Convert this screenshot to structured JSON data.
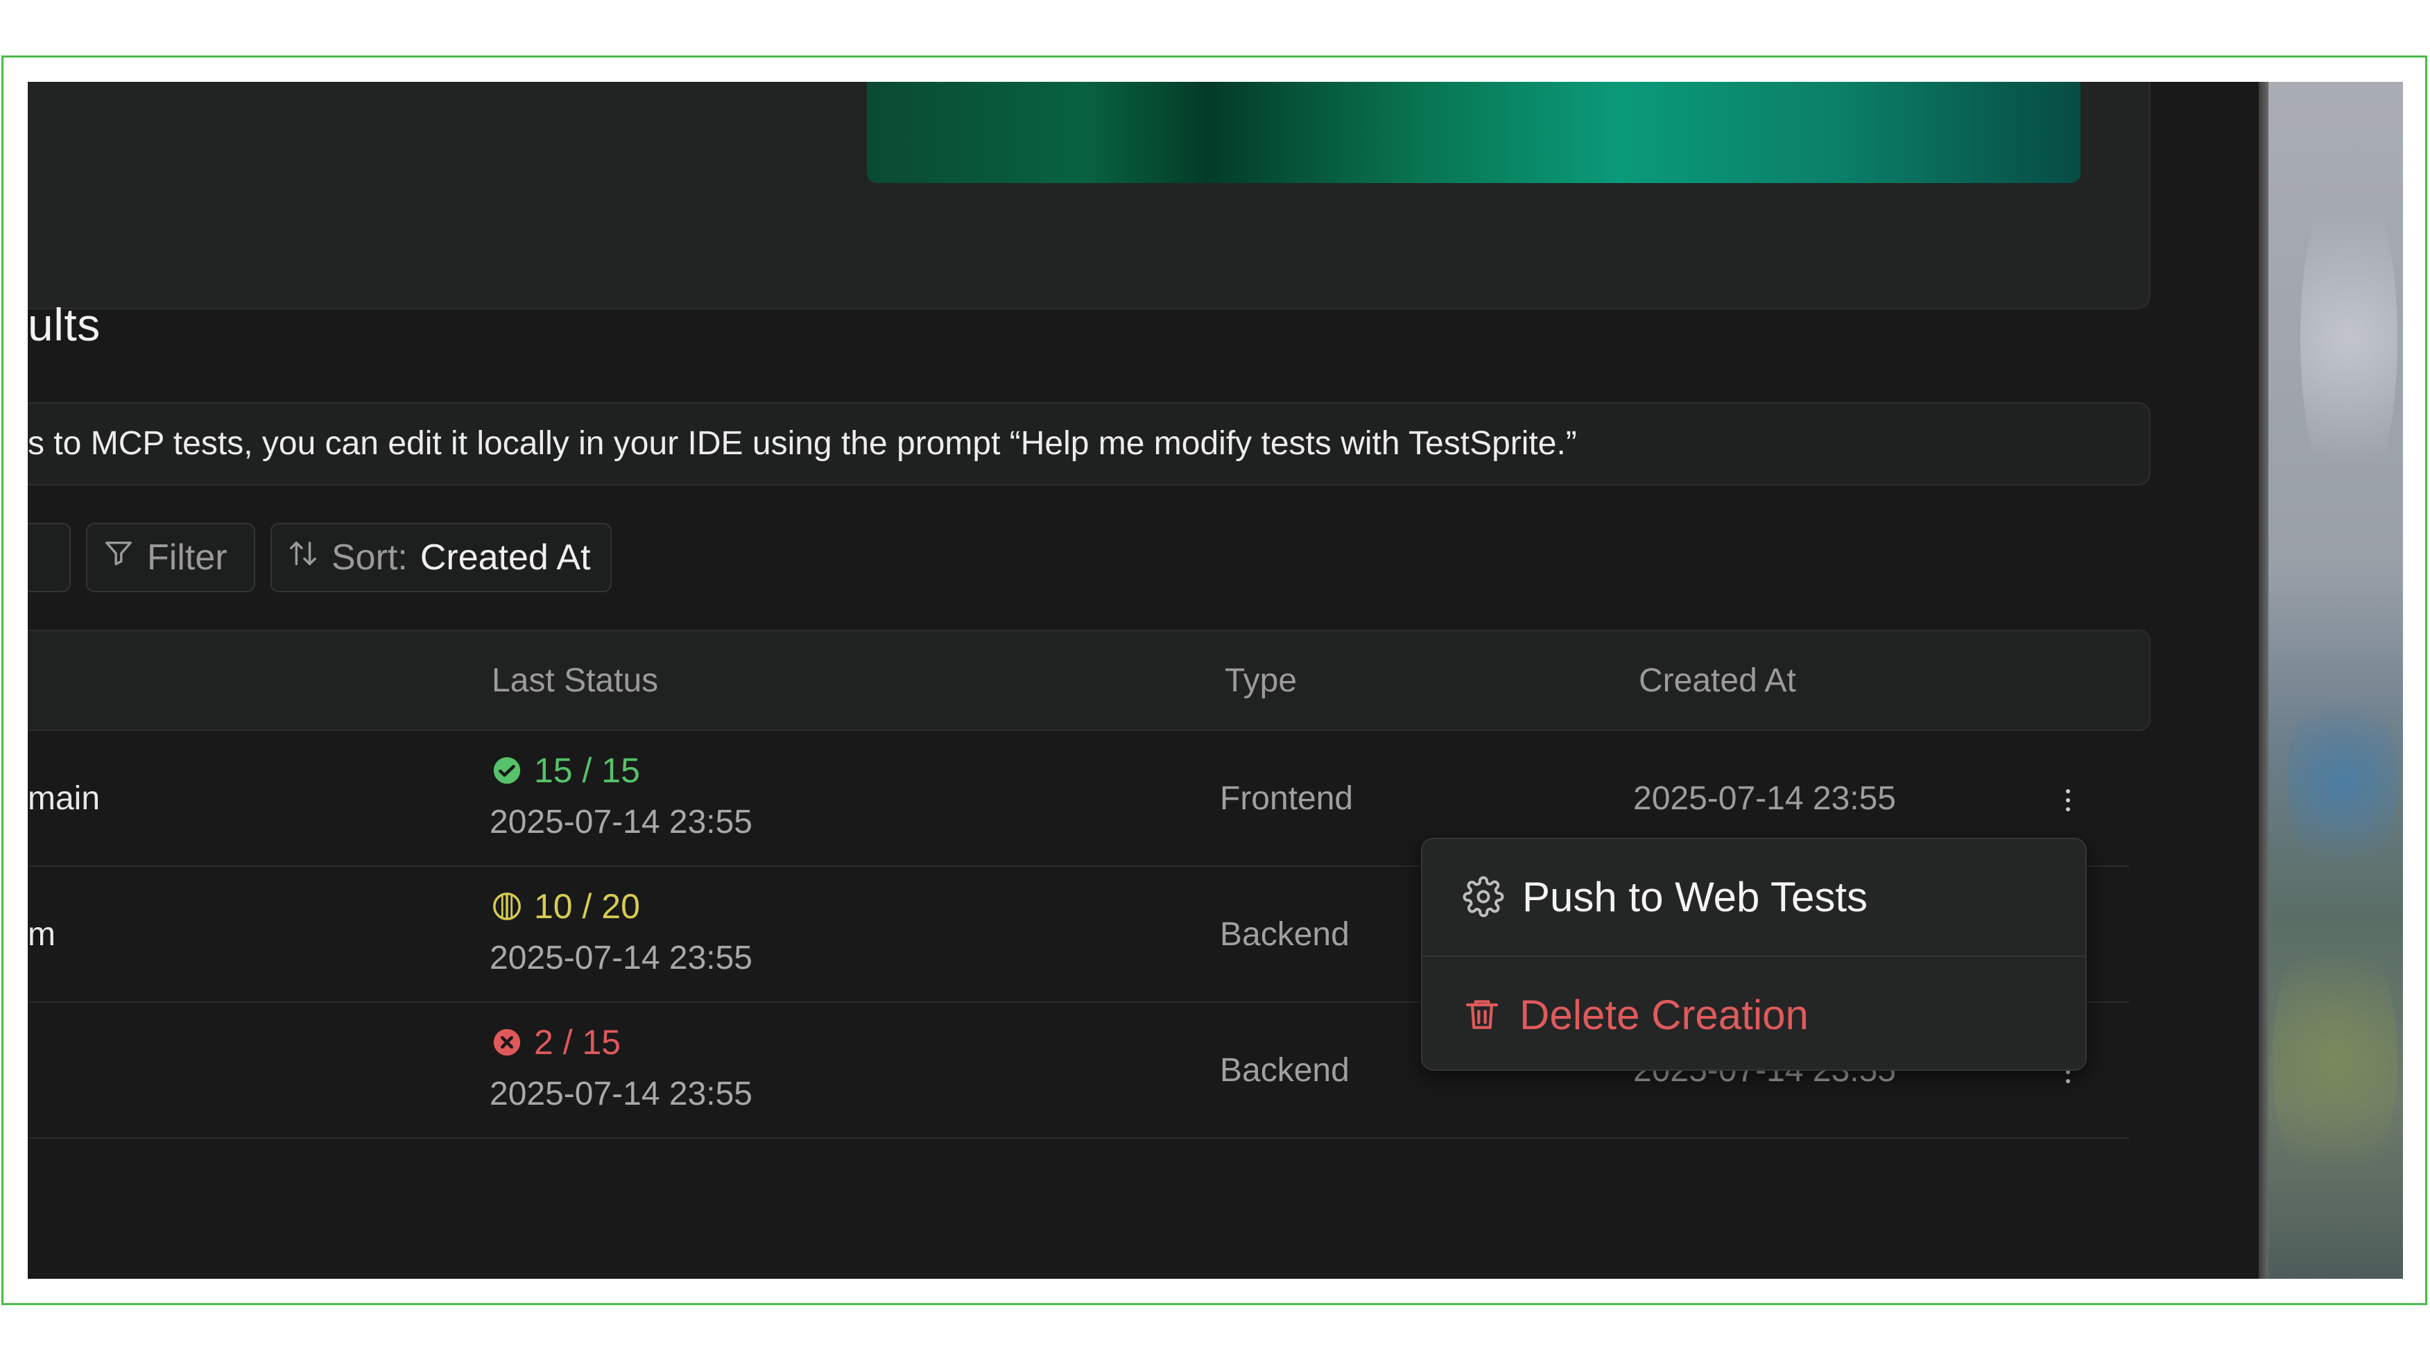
{
  "section": {
    "title_fragment": "ults"
  },
  "notice": {
    "text": "s to MCP tests, you can edit it locally in your IDE using the prompt “Help me modify tests with TestSprite.”"
  },
  "toolbar": {
    "filter_label": "Filter",
    "sort_prefix": "Sort:",
    "sort_value": "Created At"
  },
  "table": {
    "headers": {
      "last_status": "Last Status",
      "type": "Type",
      "created_at": "Created At"
    },
    "rows": [
      {
        "name": "main",
        "status_text": "15 / 15",
        "status_kind": "pass",
        "status_date": "2025-07-14 23:55",
        "type": "Frontend",
        "created_at": "2025-07-14 23:55"
      },
      {
        "name": "m",
        "status_text": "10 / 20",
        "status_kind": "partial",
        "status_date": "2025-07-14 23:55",
        "type": "Backend",
        "created_at": "2025-07-14 23:55"
      },
      {
        "name": "",
        "status_text": "2 / 15",
        "status_kind": "fail",
        "status_date": "2025-07-14 23:55",
        "type": "Backend",
        "created_at": "2025-07-14 23:55"
      }
    ]
  },
  "context_menu": {
    "push_label": "Push to Web Tests",
    "delete_label": "Delete Creation"
  },
  "colors": {
    "pass": "#56c26a",
    "partial": "#d6cc52",
    "fail": "#e0595a",
    "accent_green": "#0a9a7a"
  },
  "icons": [
    "filter-icon",
    "sort-icon",
    "check-circle-icon",
    "half-circle-icon",
    "x-circle-icon",
    "kebab-icon",
    "gear-upload-icon",
    "trash-icon"
  ]
}
